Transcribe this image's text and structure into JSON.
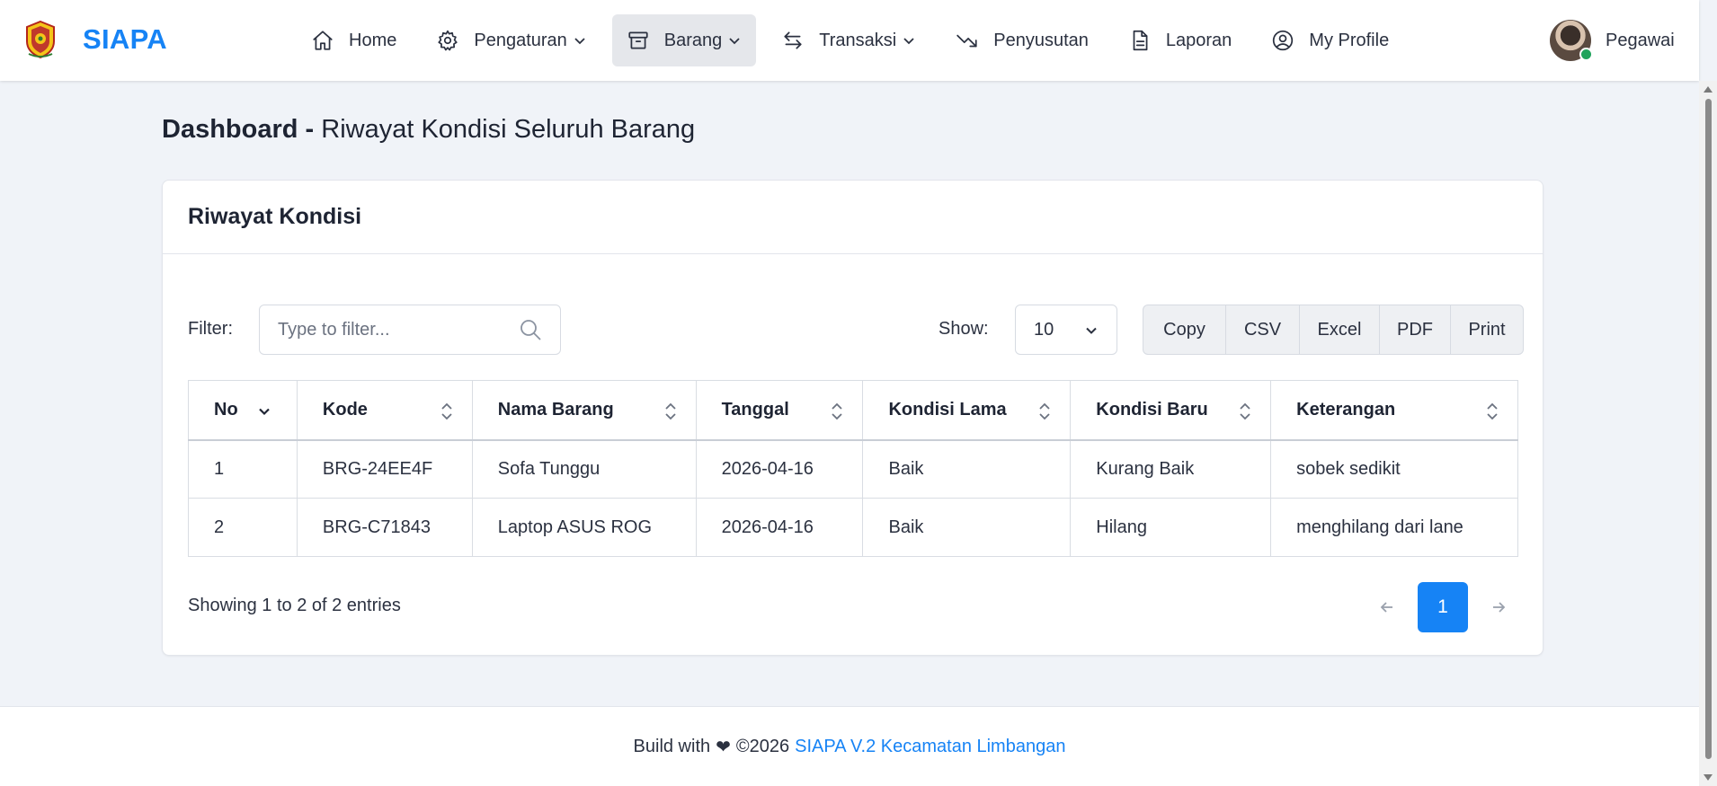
{
  "brand": {
    "name": "SIAPA",
    "logo_icon": "emblem-logo"
  },
  "nav": {
    "items": [
      {
        "label": "Home",
        "icon": "home-icon",
        "dropdown": false,
        "active": false
      },
      {
        "label": "Pengaturan",
        "icon": "gear-icon",
        "dropdown": true,
        "active": false
      },
      {
        "label": "Barang",
        "icon": "archive-box-icon",
        "dropdown": true,
        "active": true
      },
      {
        "label": "Transaksi",
        "icon": "arrows-swap-icon",
        "dropdown": true,
        "active": false
      },
      {
        "label": "Penyusutan",
        "icon": "trend-down-icon",
        "dropdown": false,
        "active": false
      },
      {
        "label": "Laporan",
        "icon": "document-icon",
        "dropdown": false,
        "active": false
      },
      {
        "label": "My Profile",
        "icon": "user-circle-icon",
        "dropdown": false,
        "active": false
      }
    ],
    "user": {
      "name": "Pegawai",
      "status_color": "#1fa35b"
    }
  },
  "page": {
    "title_bold": "Dashboard -",
    "title_rest": "Riwayat Kondisi Seluruh Barang"
  },
  "card": {
    "title": "Riwayat Kondisi",
    "filter": {
      "label": "Filter:",
      "placeholder": "Type to filter...",
      "value": ""
    },
    "show": {
      "label": "Show:",
      "value": "10"
    },
    "buttons": [
      "Copy",
      "CSV",
      "Excel",
      "PDF",
      "Print"
    ],
    "table": {
      "columns": [
        "No",
        "Kode",
        "Nama Barang",
        "Tanggal",
        "Kondisi Lama",
        "Kondisi Baru",
        "Keterangan"
      ],
      "rows": [
        [
          "1",
          "BRG-24EE4F",
          "Sofa Tunggu",
          "2026-04-16",
          "Baik",
          "Kurang Baik",
          "sobek sedikit"
        ],
        [
          "2",
          "BRG-C71843",
          "Laptop ASUS ROG",
          "2026-04-16",
          "Baik",
          "Hilang",
          "menghilang dari lane"
        ]
      ]
    },
    "info": "Showing 1 to 2 of 2 entries",
    "pagination": {
      "current_page": "1"
    }
  },
  "footer": {
    "prefix": "Build with",
    "heart": "❤",
    "copyright": "©2026",
    "link": "SIAPA V.2 Kecamatan Limbangan"
  },
  "colors": {
    "accent": "#1683f5",
    "background": "#f0f3f8",
    "nav_active": "#e5e7eb"
  }
}
